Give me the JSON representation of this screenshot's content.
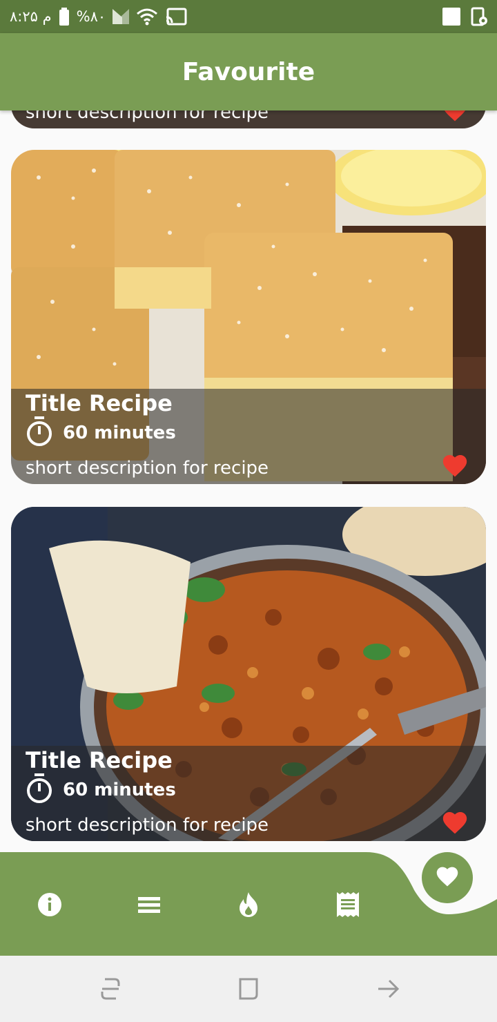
{
  "status_bar": {
    "time": "۸:۲۵ م",
    "battery": "%۸۰",
    "icons": [
      "battery-icon",
      "signal-icon",
      "wifi-icon",
      "cast-icon",
      "notification-square-icon",
      "screen-lock-icon"
    ]
  },
  "app_bar": {
    "title": "Favourite"
  },
  "partial_card": {
    "description": "short description for recipe",
    "favourite_icon": "heart-icon"
  },
  "recipes": [
    {
      "title": "Title Recipe",
      "time": "60 minutes",
      "description": "short description for recipe",
      "image": "lemon-cake-photo",
      "favourite_icon": "heart-icon"
    },
    {
      "title": "Title Recipe",
      "time": "60 minutes",
      "description": "short description for recipe",
      "image": "curry-pan-photo",
      "favourite_icon": "heart-icon"
    }
  ],
  "bottom_nav": {
    "items": [
      "info-icon",
      "list-icon",
      "fire-icon",
      "receipt-icon"
    ],
    "active_item": "heart-icon"
  },
  "system_nav": {
    "buttons": [
      "recent-apps-icon",
      "home-icon",
      "back-icon"
    ]
  },
  "colors": {
    "accent": "#7a9d54",
    "status_bar": "#5b7a3c",
    "favourite": "#ee3b2f"
  }
}
